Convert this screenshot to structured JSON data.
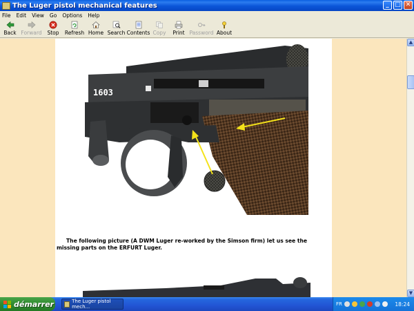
{
  "window": {
    "title": "The Luger pistol mechanical features",
    "minimize": "_",
    "maximize": "□",
    "close": "✕"
  },
  "menu": [
    "File",
    "Edit",
    "View",
    "Go",
    "Options",
    "Help"
  ],
  "toolbar": {
    "back": "Back",
    "forward": "Forward",
    "stop": "Stop",
    "refresh": "Refresh",
    "home": "Home",
    "search": "Search",
    "contents": "Contents",
    "copy": "Copy",
    "print": "Print",
    "password": "Password",
    "about": "About"
  },
  "content": {
    "photo_serial": "1603",
    "caption": "The following picture (A DWM Luger re-worked by the Simson firm) let us see the missing parts on the ERFURT Luger."
  },
  "taskbar": {
    "start": "démarrer",
    "task": "The Luger pistol mech...",
    "lang": "FR",
    "clock": "18:24"
  },
  "colors": {
    "page_background": "#fbe6bd",
    "titlebar": "#0b55d8",
    "taskbar": "#2255d4",
    "start_button": "#2f8a2f"
  }
}
